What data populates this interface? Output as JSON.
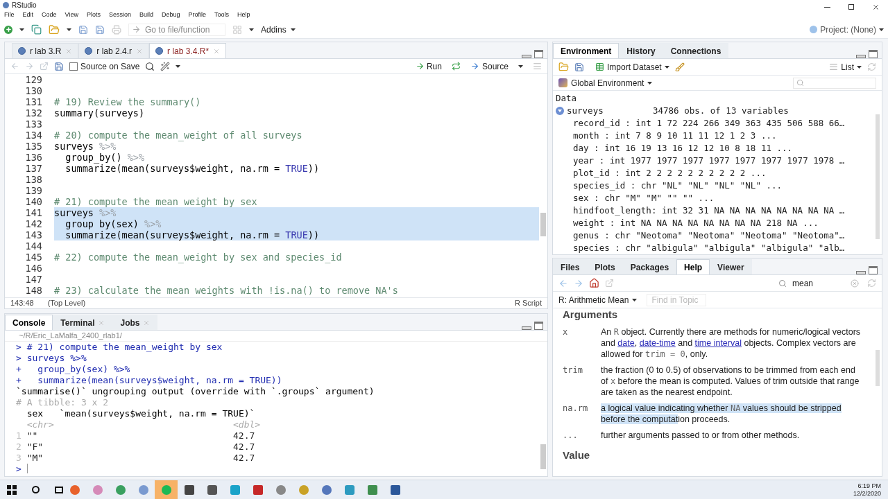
{
  "window": {
    "title": "RStudio"
  },
  "menu": [
    "File",
    "Edit",
    "Code",
    "View",
    "Plots",
    "Session",
    "Build",
    "Debug",
    "Profile",
    "Tools",
    "Help"
  ],
  "toolbar": {
    "goto_placeholder": "Go to file/function",
    "addins": "Addins",
    "project": "Project: (None)"
  },
  "editor": {
    "tabs": [
      {
        "label": "r lab 3.R",
        "selected": false
      },
      {
        "label": "r lab 2.4.r",
        "selected": false
      },
      {
        "label": "r lab 3.4.R*",
        "selected": true
      }
    ],
    "source_on_save": {
      "label": "Source on Save",
      "checked": false
    },
    "run": "Run",
    "source": "Source",
    "lines": [
      {
        "number": "129",
        "selected": false
      },
      {
        "number": "130",
        "selected": false
      },
      {
        "number": "131",
        "selected": false,
        "tokens": [
          {
            "kind": "comment",
            "text": "# 19) Review the summary()"
          }
        ]
      },
      {
        "number": "132",
        "selected": false,
        "tokens": [
          {
            "kind": "code",
            "text": "summary(surveys)"
          }
        ]
      },
      {
        "number": "133",
        "selected": false
      },
      {
        "number": "134",
        "selected": false,
        "tokens": [
          {
            "kind": "comment",
            "text": "# 20) compute the mean_weight of all surveys"
          }
        ]
      },
      {
        "number": "135",
        "selected": false,
        "tokens": [
          {
            "kind": "code",
            "text": "surveys "
          },
          {
            "kind": "pipe",
            "text": "%>%"
          }
        ]
      },
      {
        "number": "136",
        "selected": false,
        "tokens": [
          {
            "kind": "code",
            "text": "  group_by() "
          },
          {
            "kind": "pipe",
            "text": "%>%"
          }
        ]
      },
      {
        "number": "137",
        "selected": false,
        "tokens": [
          {
            "kind": "code",
            "text": "  summarize(mean(surveys$weight, na.rm = "
          },
          {
            "kind": "constant",
            "text": "TRUE"
          },
          {
            "kind": "code",
            "text": "))"
          }
        ]
      },
      {
        "number": "138",
        "selected": false
      },
      {
        "number": "139",
        "selected": false
      },
      {
        "number": "140",
        "selected": false,
        "tokens": [
          {
            "kind": "comment",
            "text": "# 21) compute the mean_weight by sex"
          }
        ]
      },
      {
        "number": "141",
        "selected": true,
        "tokens": [
          {
            "kind": "code",
            "text": "surveys "
          },
          {
            "kind": "pipe",
            "text": "%>%"
          }
        ]
      },
      {
        "number": "142",
        "selected": true,
        "tokens": [
          {
            "kind": "code",
            "text": "  group_by(sex) "
          },
          {
            "kind": "pipe",
            "text": "%>%"
          }
        ]
      },
      {
        "number": "143",
        "selected": true,
        "tokens": [
          {
            "kind": "code",
            "text": "  summarize(mean(surveys$weight, na.rm = "
          },
          {
            "kind": "constant",
            "text": "TRUE"
          },
          {
            "kind": "code",
            "text": "))"
          }
        ]
      },
      {
        "number": "144",
        "selected": false
      },
      {
        "number": "145",
        "selected": false,
        "tokens": [
          {
            "kind": "comment",
            "text": "# 22) compute the mean_weight by sex and species_id"
          }
        ]
      },
      {
        "number": "146",
        "selected": false
      },
      {
        "number": "147",
        "selected": false
      },
      {
        "number": "148",
        "selected": false,
        "tokens": [
          {
            "kind": "comment",
            "text": "# 23) calculate the mean weights with !is.na() to remove NA's"
          }
        ]
      }
    ],
    "status": {
      "position": "143:48",
      "scope": "(Top Level)",
      "type": "R Script"
    }
  },
  "console": {
    "tabs": [
      {
        "label": "Console",
        "selected": true
      },
      {
        "label": "Terminal",
        "selected": false
      },
      {
        "label": "Jobs",
        "selected": false
      }
    ],
    "path": "~/R/Eric_LaMalfa_2400_rlab1/",
    "lines": [
      {
        "kind": "input",
        "prompt": ">",
        "text": "# 21) compute the mean_weight by sex"
      },
      {
        "kind": "input",
        "prompt": ">",
        "text": "surveys %>%"
      },
      {
        "kind": "input",
        "prompt": "+",
        "text": "  group_by(sex) %>%"
      },
      {
        "kind": "input",
        "prompt": "+",
        "text": "  summarize(mean(surveys$weight, na.rm = TRUE))"
      },
      {
        "kind": "output",
        "text": "`summarise()` ungrouping output (override with `.groups` argument)"
      },
      {
        "kind": "muted",
        "text": "# A tibble: 3 x 2"
      },
      {
        "kind": "output",
        "text": "  sex   `mean(surveys$weight, na.rm = TRUE)`"
      },
      {
        "kind": "types",
        "cells": [
          "<chr>",
          "<dbl>"
        ]
      },
      {
        "kind": "row",
        "index": "1",
        "cells": [
          "\"\"",
          "42.7"
        ]
      },
      {
        "kind": "row",
        "index": "2",
        "cells": [
          "\"F\"",
          "42.7"
        ]
      },
      {
        "kind": "row",
        "index": "3",
        "cells": [
          "\"M\"",
          "42.7"
        ]
      },
      {
        "kind": "input",
        "prompt": ">"
      }
    ]
  },
  "environment": {
    "tabs": [
      {
        "label": "Environment",
        "selected": true
      },
      {
        "label": "History",
        "selected": false
      },
      {
        "label": "Connections",
        "selected": false
      }
    ],
    "import": "Import Dataset",
    "view": "List",
    "scope": "Global Environment",
    "heading": "Data",
    "object": {
      "name": "surveys",
      "summary": "34786 obs. of 13 variables",
      "expanded": true,
      "fields": [
        "record_id : int 1 72 224 266 349 363 435 506 588 66…",
        "month : int 7 8 9 10 11 11 12 1 2 3 ...",
        "day : int 16 19 13 16 12 12 10 8 18 11 ...",
        "year : int 1977 1977 1977 1977 1977 1977 1977 1978 …",
        "plot_id : int 2 2 2 2 2 2 2 2 2 2 ...",
        "species_id : chr \"NL\" \"NL\" \"NL\" \"NL\" ...",
        "sex : chr \"M\" \"M\" \"\" \"\" ...",
        "hindfoot_length: int 32 31 NA NA NA NA NA NA NA NA …",
        "weight : int NA NA NA NA NA NA NA NA 218 NA ...",
        "genus : chr \"Neotoma\" \"Neotoma\" \"Neotoma\" \"Neotoma\"…",
        "species : chr \"albigula\" \"albigula\" \"albigula\" \"alb…"
      ]
    }
  },
  "help": {
    "tabs": [
      {
        "label": "Files",
        "selected": false
      },
      {
        "label": "Plots",
        "selected": false
      },
      {
        "label": "Packages",
        "selected": false
      },
      {
        "label": "Help",
        "selected": true
      },
      {
        "label": "Viewer",
        "selected": false
      }
    ],
    "search": "mean",
    "topic": "R: Arithmetic Mean",
    "find_placeholder": "Find in Topic",
    "section": "Arguments",
    "arguments": [
      {
        "name": "x",
        "description": [
          {
            "kind": "text",
            "text": "An "
          },
          {
            "kind": "code",
            "text": "R"
          },
          {
            "kind": "text",
            "text": " object. Currently there are methods for numeric/logical vectors and "
          },
          {
            "kind": "link",
            "text": "date"
          },
          {
            "kind": "text",
            "text": ", "
          },
          {
            "kind": "link",
            "text": "date-time"
          },
          {
            "kind": "text",
            "text": " and "
          },
          {
            "kind": "link",
            "text": "time interval"
          },
          {
            "kind": "text",
            "text": " objects. Complex vectors are allowed for "
          },
          {
            "kind": "code",
            "text": "trim = 0"
          },
          {
            "kind": "text",
            "text": ", only."
          }
        ]
      },
      {
        "name": "trim",
        "description": [
          {
            "kind": "text",
            "text": "the fraction (0 to 0.5) of observations to be trimmed from each end of "
          },
          {
            "kind": "code",
            "text": "x"
          },
          {
            "kind": "text",
            "text": " before the mean is computed. Values of trim outside that range are taken as the nearest endpoint."
          }
        ]
      },
      {
        "name": "na.rm",
        "description": [
          {
            "kind": "selected",
            "text": "a logical value indicating whether "
          },
          {
            "kind": "selected_code",
            "text": "NA"
          },
          {
            "kind": "selected",
            "text": " values should be stripped before the computat"
          },
          {
            "kind": "text",
            "text": "ion proceeds."
          }
        ]
      },
      {
        "name": "...",
        "description": [
          {
            "kind": "text",
            "text": "further arguments passed to or from other methods."
          }
        ]
      }
    ],
    "next_section": "Value"
  },
  "taskbar": {
    "time": "6:19 PM",
    "date": "12/2/2020"
  }
}
